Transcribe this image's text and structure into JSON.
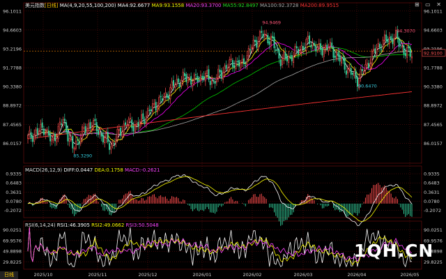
{
  "header": {
    "symbol": "美元指数",
    "period": "日线",
    "ma_params": "MA(4,9,20,55,100,200)",
    "ma4": "MA4:92.6677",
    "ma9": "MA9:93.1558",
    "ma20": "MA20:93.3700",
    "ma55": "MA55:92.8497",
    "ma100": "MA100:92.3728",
    "ma200": "MA200:89.9515"
  },
  "window_icons": "⊞ ▭ ✕",
  "macd_header": {
    "params": "MACD(26,12,9)",
    "diff": "DIFF:0.0447",
    "dea": "DEA:0.1758",
    "macd": "MACD:-0.2621"
  },
  "rsi_header": {
    "params": "RSI(6,14,24)",
    "rsi1": "RSI1:46.3905",
    "rsi2": "RSI2:49.0662",
    "rsi3": "RSI3:50.5048"
  },
  "watermark": "1QH.CN",
  "footer_tab": "日线",
  "current_price": "92.9100",
  "colors": {
    "up": "#ff4d4d",
    "down": "#33cc99",
    "ma4": "#ffffff",
    "ma9": "#ffff00",
    "ma20": "#ff00ff",
    "ma55": "#00cc00",
    "ma100": "#aaaaaa",
    "ma200": "#ff3333",
    "grid": "#7a1010",
    "axis_text": "#d0d0d0",
    "price_axis": "#ff5555"
  },
  "chart_data": [
    {
      "type": "candlestick",
      "title": "美元指数 日线",
      "ylim": [
        84.6,
        96.2
      ],
      "y_ticks_left": [
        "96.1011",
        "94.6603",
        "93.2196",
        "91.7788",
        "90.3380",
        "88.8972",
        "87.4565",
        "86.0157"
      ],
      "y_ticks_right": [
        "96.1011",
        "94.6603",
        "93.2196",
        "91.7788",
        "90.3380",
        "88.8972",
        "87.4565",
        "86.0157"
      ],
      "x_ticks": [
        "2025/10",
        "2025/11",
        "2025/12",
        "2026/01",
        "2026/02",
        "2026/03",
        "2026/04",
        "2026/05"
      ],
      "annotations": [
        {
          "label": "85.3290",
          "value": 85.329
        },
        {
          "label": "94.9469",
          "value": 94.9469
        },
        {
          "label": "90.6470",
          "value": 90.647
        },
        {
          "label": "94.3070",
          "value": 94.307
        }
      ],
      "anchors": [
        [
          0,
          86.4
        ],
        [
          10,
          87.2
        ],
        [
          15,
          86.1
        ],
        [
          22,
          87.8
        ],
        [
          28,
          85.6
        ],
        [
          34,
          86.8
        ],
        [
          40,
          87.6
        ],
        [
          46,
          86.6
        ],
        [
          52,
          85.8
        ],
        [
          58,
          87.0
        ],
        [
          62,
          87.6
        ],
        [
          68,
          87.3
        ],
        [
          74,
          88.2
        ],
        [
          80,
          89.0
        ],
        [
          86,
          89.6
        ],
        [
          92,
          90.6
        ],
        [
          98,
          91.0
        ],
        [
          104,
          90.8
        ],
        [
          110,
          91.2
        ],
        [
          116,
          90.7
        ],
        [
          122,
          91.6
        ],
        [
          128,
          92.2
        ],
        [
          134,
          92.0
        ],
        [
          140,
          93.4
        ],
        [
          146,
          94.3
        ],
        [
          152,
          93.9
        ],
        [
          158,
          92.4
        ],
        [
          164,
          92.6
        ],
        [
          170,
          93.2
        ],
        [
          176,
          93.8
        ],
        [
          182,
          93.1
        ],
        [
          188,
          93.4
        ],
        [
          194,
          92.6
        ],
        [
          200,
          91.6
        ],
        [
          206,
          90.9
        ],
        [
          212,
          92.0
        ],
        [
          218,
          93.3
        ],
        [
          224,
          93.9
        ],
        [
          230,
          94.1
        ],
        [
          236,
          92.9
        ],
        [
          240,
          92.9
        ]
      ],
      "series": [
        "MA4",
        "MA9",
        "MA20",
        "MA55",
        "MA100",
        "MA200"
      ]
    },
    {
      "type": "line",
      "title": "MACD(26,12,9)",
      "y_ticks_left": [
        "0.9335",
        "0.6483",
        "0.3631",
        "0.0780",
        "-0.2072"
      ],
      "y_ticks_right": [
        "0.9335",
        "0.6483",
        "0.3631",
        "0.0780",
        "-0.2072"
      ],
      "series": [
        "DIFF",
        "DEA",
        "MACD"
      ]
    },
    {
      "type": "line",
      "title": "RSI(6,14,24)",
      "y_ticks_left": [
        "90.0251",
        "69.9576",
        "49.8898",
        "29.8225"
      ],
      "y_ticks_right": [
        "90.0251",
        "69.9576",
        "49.8898",
        "29.8225"
      ],
      "series": [
        "RSI1",
        "RSI2",
        "RSI3"
      ]
    }
  ]
}
